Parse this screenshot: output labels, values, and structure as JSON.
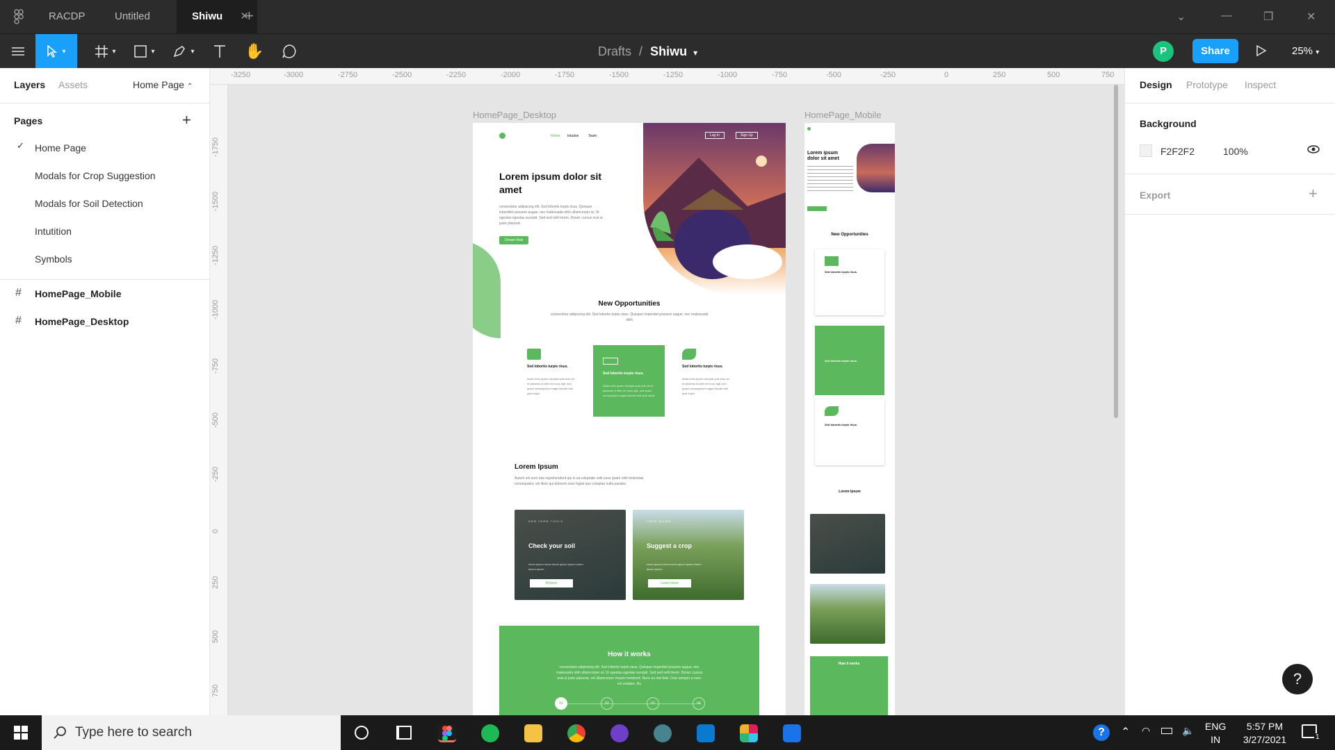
{
  "titlebar": {
    "tabs": [
      {
        "label": "RACDP"
      },
      {
        "label": "Untitled"
      },
      {
        "label": "Shiwu"
      }
    ]
  },
  "toolbar": {
    "breadcrumb_parent": "Drafts",
    "breadcrumb_sep": "/",
    "file_name": "Shiwu",
    "avatar_initial": "P",
    "share_label": "Share",
    "zoom": "25%"
  },
  "left_panel": {
    "tabs": [
      "Layers",
      "Assets"
    ],
    "current_page": "Home Page",
    "pages_heading": "Pages",
    "pages": [
      "Home Page",
      "Modals for Crop Suggestion",
      "Modals for Soil Detection",
      "Intutition",
      "Symbols"
    ],
    "frames": [
      "HomePage_Mobile",
      "HomePage_Desktop"
    ]
  },
  "right_panel": {
    "tabs": [
      "Design",
      "Prototype",
      "Inspect"
    ],
    "background_heading": "Background",
    "bg_color": "F2F2F2",
    "bg_opacity": "100%",
    "export_heading": "Export"
  },
  "canvas": {
    "ruler_x": [
      "-3250",
      "-3000",
      "-2750",
      "-2500",
      "-2250",
      "-2000",
      "-1750",
      "-1500",
      "-1250",
      "-1000",
      "-750",
      "-500",
      "-250",
      "0",
      "250",
      "500",
      "750"
    ],
    "ruler_y": [
      "-1750",
      "-1500",
      "-1250",
      "-1000",
      "-750",
      "-500",
      "-250",
      "0",
      "250",
      "500",
      "750"
    ],
    "desktop_label": "HomePage_Desktop",
    "mobile_label": "HomePage_Mobile",
    "desktop": {
      "nav_links": [
        "Home",
        "Intution",
        "Team"
      ],
      "nav_buttons": [
        "Log In",
        "Sign Up"
      ],
      "hero_title": "Lorem ipsum dolor sit amet",
      "hero_body": "consectetur adipiscing elit. Sed lobortis turpis risus. Quisque imperdiet posuere augue, nec malesuada nibh ullamcorper at. Ut egestas egestas suscipit. Sed sed velit lorem. Donec cursus erat ut justo placerat.",
      "hero_button": "Dream Now",
      "opps_title": "New Opportunities",
      "opps_body": "consectetur adipiscing elit. Sed lobortis turpis risus. Quisque imperdiet posuere augue, nec malesuada nibh",
      "card_title": "Sed lobortis turpis risus.",
      "card_body": "Nulla enim quam volutpat quis erat vel et placerat ut nibh vel nunc ligit, sed quam consequatur magni blandit velit quis turpis",
      "ipsum_title": "Lorem Ipsum",
      "ipsum_body": "Autem vel eum iure reprehenderit qui in ea voluptate velit esse quam nihil molestiae consequatur, vel illum qui dolorem eum fugiat quo voluptas nulla pariatur",
      "soil_card": {
        "kicker": "NEW FARM TOOLS",
        "title": "Check your soil",
        "body": "lorem ipsum lorem lorem ipsum ipsum lorem ipsum ipsum",
        "button": "Browse"
      },
      "crop_card": {
        "kicker": "CROP GUIDE",
        "title": "Suggest a crop",
        "body": "lorem ipsum lorem lorem ipsum ipsum lorem ipsum ipsum",
        "button": "Learn more"
      },
      "how_title": "How it works",
      "how_body": "consectetur adipiscing elit. Sed lobortis turpis risus. Quisque imperdiet posuere augue, nec malesuada nibh ullamcorper at. Ut egestas egestas suscipit. Sed sed velit lorem. Donec cursus erat ut justo placerat, vel ullamcorper mauris hendrerit. Nunc eu nisi felis. Duis semper a nunc vel sodales. Nu",
      "steps": [
        "01",
        "02",
        "03",
        "04"
      ]
    },
    "mobile": {
      "hero_title": "Lorem ipsum dolor sit amet",
      "opps_title": "New Opportunities",
      "card_title": "Sed lobortis turpis risus.",
      "ipsum_title": "Lorem Ipsum",
      "how_title": "How it works"
    }
  },
  "taskbar": {
    "search_placeholder": "Type here to search",
    "lang1": "ENG",
    "lang2": "IN",
    "time": "5:57 PM",
    "date": "3/27/2021",
    "notif_count": "1"
  },
  "help_label": "?",
  "colors": {
    "accent": "#18a0fb",
    "green": "#5cb85c",
    "avatar": "#1bc47d"
  }
}
